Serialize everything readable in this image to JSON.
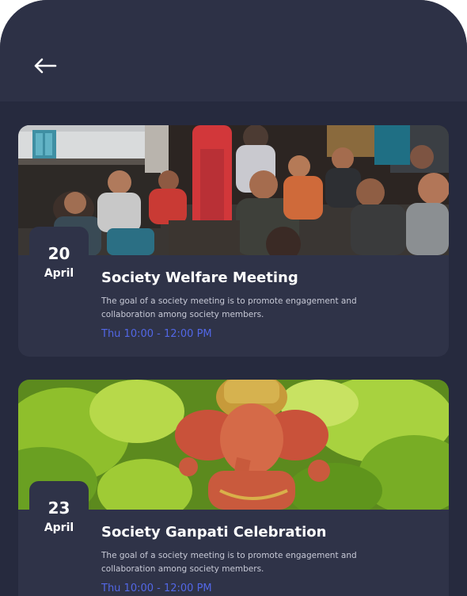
{
  "header": {
    "back_icon": "arrow-left-icon"
  },
  "events": [
    {
      "day": "20",
      "month": "April",
      "title": "Society Welfare Meeting",
      "description": "The goal of a society meeting is to promote engagement and collaboration among society members.",
      "time": "Thu 10:00 - 12:00 PM",
      "image": "group-meeting-photo"
    },
    {
      "day": "23",
      "month": "April",
      "title": "Society Ganpati Celebration",
      "description": "The goal of a society meeting is to promote engagement and collaboration among society members.",
      "time": "Thu 10:00 - 12:00 PM",
      "image": "ganpati-idol-photo"
    }
  ],
  "colors": {
    "background": "#262a3e",
    "appbar": "#2d3146",
    "card": "#2f3348",
    "accent": "#5267e6",
    "text_primary": "#ffffff",
    "text_secondary": "#c7c9d6"
  }
}
